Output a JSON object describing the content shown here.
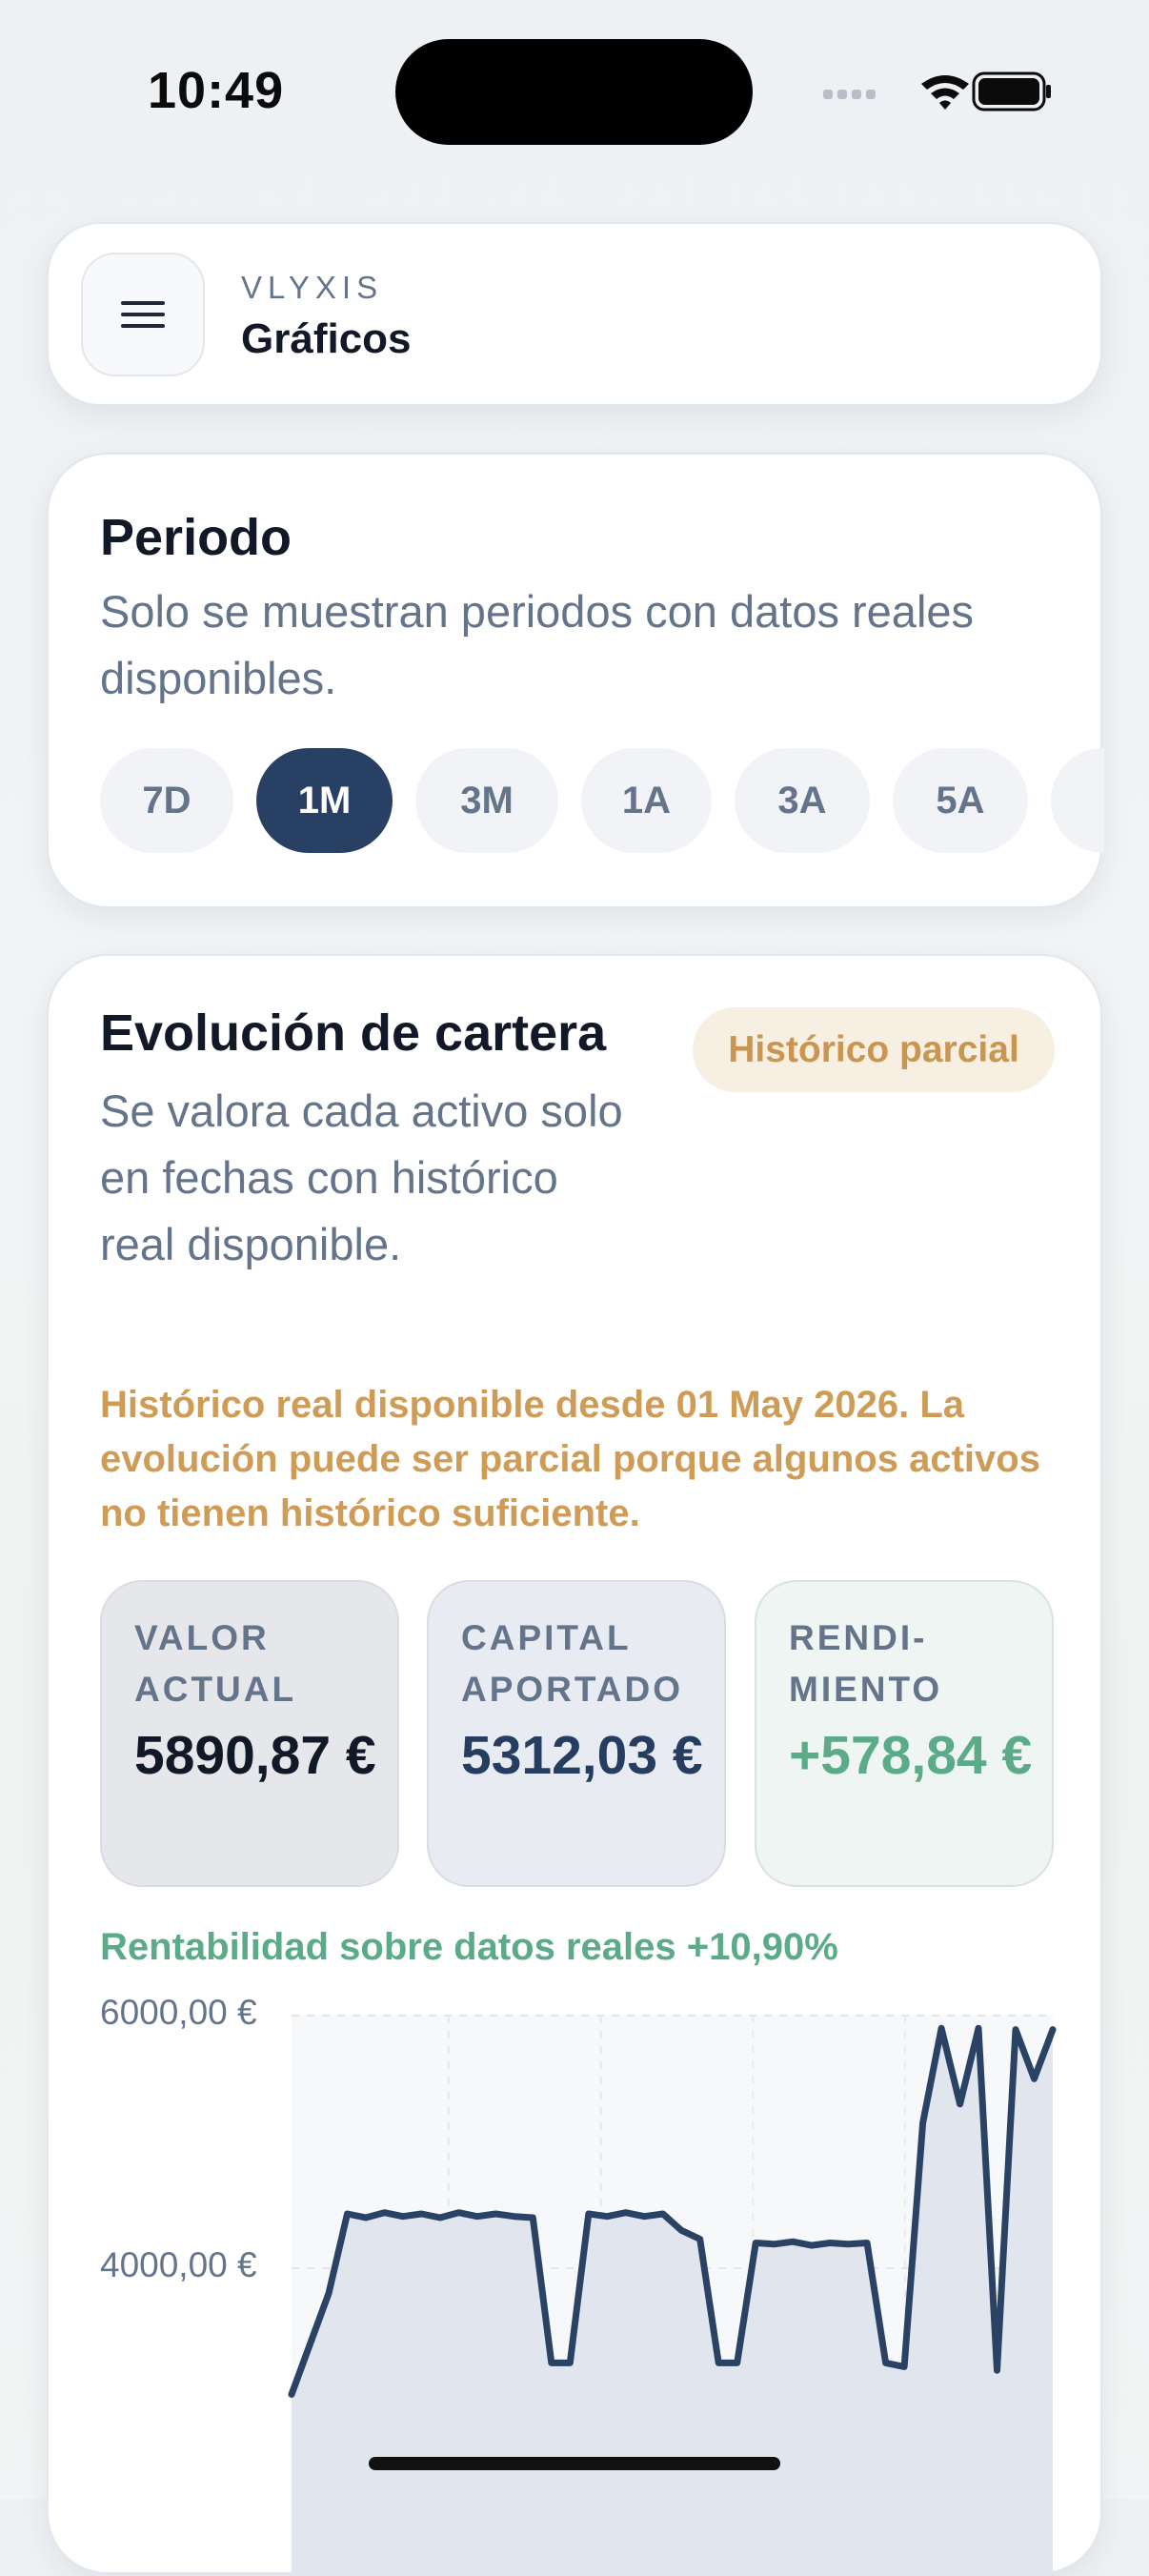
{
  "status_bar": {
    "time": "10:49"
  },
  "header": {
    "brand": "VLYXIS",
    "title": "Gráficos"
  },
  "period": {
    "title": "Periodo",
    "description": "Solo se muestran periodos con datos reales disponibles.",
    "options": [
      "7D",
      "1M",
      "3M",
      "1A",
      "3A",
      "5A"
    ],
    "selected": "1M"
  },
  "evolution": {
    "title": "Evolución de cartera",
    "description": "Se valora cada activo solo en fechas con histórico real disponible.",
    "badge": "Histórico parcial",
    "warning": "Histórico real disponible desde 01 May 2026. La evolución puede ser parcial porque algunos activos no tienen histórico suficiente.",
    "stats": [
      {
        "label": "VALOR ACTUAL",
        "value": "5890,87 €"
      },
      {
        "label": "CAPITAL APORTADO",
        "value": "5312,03 €"
      },
      {
        "label": "RENDI-MIENTO",
        "value": "+578,84 €"
      }
    ],
    "return_text": "Rentabilidad sobre datos reales +10,90%"
  },
  "chart_data": {
    "type": "area",
    "y_tick_labels": [
      "6000,00 €",
      "4000,00 €"
    ],
    "y_ticks": [
      6000,
      4000
    ],
    "ylim": [
      2500,
      6100
    ],
    "grid": true,
    "x": [
      0,
      1,
      2,
      3,
      4,
      5,
      6,
      7,
      8,
      9,
      10,
      11,
      12,
      13,
      14,
      15,
      16,
      17,
      18,
      19,
      20,
      21,
      22,
      23,
      24,
      25,
      26,
      27,
      28,
      29,
      30,
      31,
      32,
      33,
      34,
      35,
      36,
      37,
      38,
      39,
      40,
      41
    ],
    "values": [
      3000,
      3400,
      3800,
      4430,
      4400,
      4440,
      4410,
      4430,
      4400,
      4440,
      4410,
      4430,
      4410,
      4400,
      3250,
      3250,
      4430,
      4410,
      4440,
      4410,
      4430,
      4300,
      4230,
      3250,
      3250,
      4200,
      4190,
      4210,
      4180,
      4200,
      4190,
      4200,
      3250,
      3220,
      5150,
      5900,
      5300,
      5900,
      3190,
      5890,
      5500,
      5890
    ],
    "colors": {
      "line": "#2a4264",
      "fill": "#dde2ea"
    }
  }
}
